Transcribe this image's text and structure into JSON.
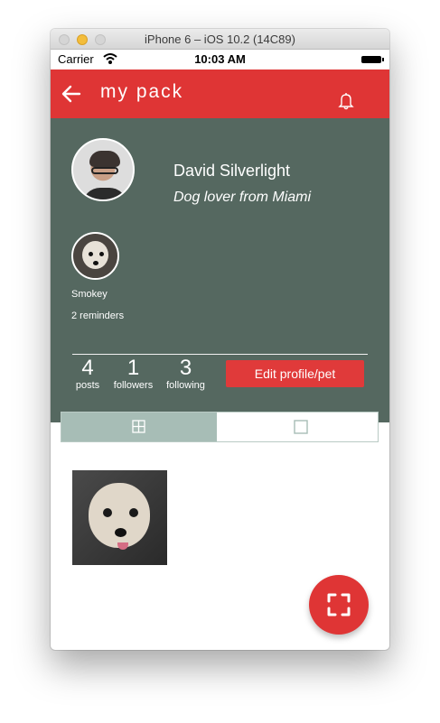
{
  "window": {
    "title": "iPhone 6 – iOS 10.2 (14C89)"
  },
  "status_bar": {
    "carrier": "Carrier",
    "time": "10:03 AM"
  },
  "nav": {
    "title": "my pack",
    "back_icon": "arrow-left-icon",
    "bell_icon": "bell-icon"
  },
  "profile": {
    "name": "David Silverlight",
    "bio": "Dog lover from Miami",
    "pet": {
      "name": "Smokey",
      "reminders": "2 reminders"
    },
    "stats": [
      {
        "value": "4",
        "label": "posts"
      },
      {
        "value": "1",
        "label": "followers"
      },
      {
        "value": "3",
        "label": "following"
      }
    ],
    "edit_label": "Edit profile/pet"
  },
  "view_toggle": {
    "selected": "grid",
    "grid_icon": "grid-icon",
    "single_icon": "square-icon"
  },
  "colors": {
    "accent": "#df3535",
    "profile_bg": "#556860",
    "segment_active": "#a7bdb6"
  }
}
